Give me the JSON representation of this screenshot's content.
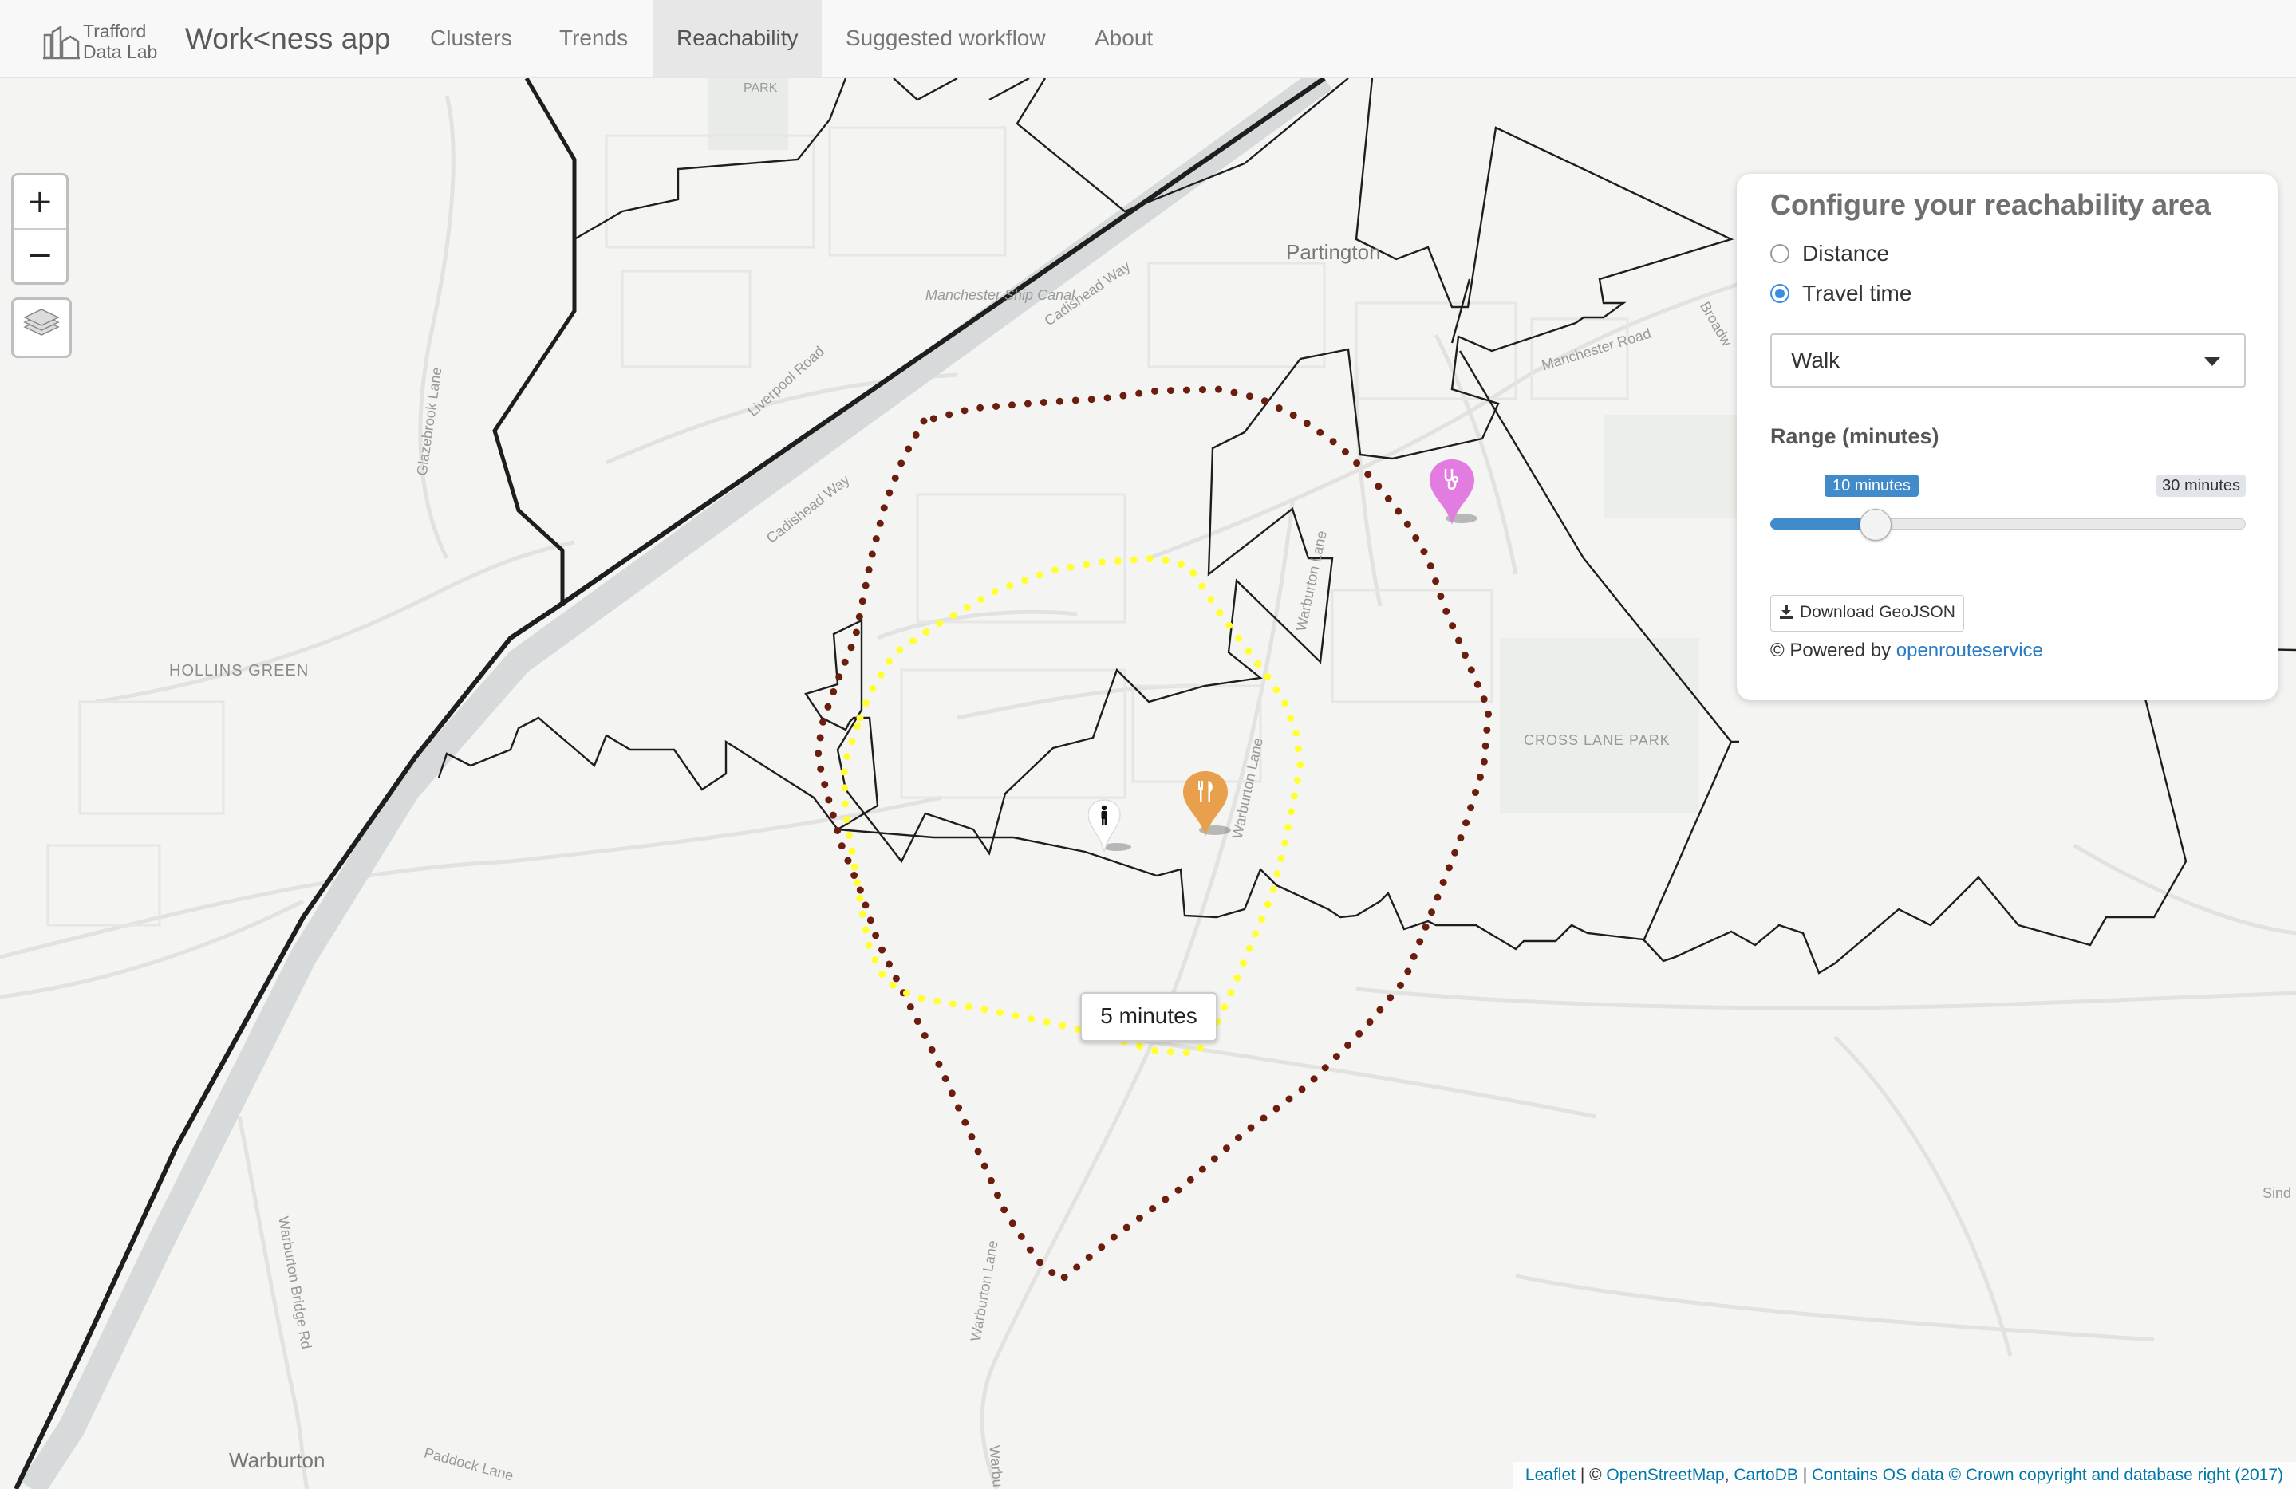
{
  "navbar": {
    "logo_text_line1": "Trafford",
    "logo_text_line2": "Data Lab",
    "brand": "Work<ness app",
    "items": [
      {
        "label": "Clusters",
        "active": false
      },
      {
        "label": "Trends",
        "active": false
      },
      {
        "label": "Reachability",
        "active": true
      },
      {
        "label": "Suggested workflow",
        "active": false
      },
      {
        "label": "About",
        "active": false
      }
    ]
  },
  "map": {
    "zoom_in": "+",
    "zoom_out": "−",
    "layers_icon": "layers-icon",
    "place_labels": {
      "partington": "Partington",
      "hollins_green": "HOLLINS GREEN",
      "warburton": "Warburton",
      "cross_lane_park": "CROSS LANE PARK",
      "park": "PARK"
    },
    "road_labels": {
      "cadishead_way_1": "Cadishead Way",
      "cadishead_way_2": "Cadishead Way",
      "liverpool_road": "Liverpool Road",
      "glazebrook_lane": "Glazebrook Lane",
      "manchester_road": "Manchester Road",
      "warburton_lane_1": "Warburton Lane",
      "warburton_lane_2": "Warburton Lane",
      "warburton_lane_3": "Warburton Lane",
      "warburton_bridge_rd": "Warburton Bridge Rd",
      "paddock_lane": "Paddock Lane",
      "ship_canal": "Manchester Ship Canal",
      "warburton_lane_4": "Warbu",
      "broadway": "Broadw",
      "sinderland": "Sind"
    },
    "isochrones": [
      {
        "minutes": 5,
        "color": "#ffff33",
        "style": "dotted"
      },
      {
        "minutes": 10,
        "color": "#6b1d0e",
        "style": "dotted"
      }
    ],
    "tooltip": "5 minutes",
    "markers": [
      {
        "type": "person",
        "icon": "person-icon",
        "color": "#ffffff"
      },
      {
        "type": "restaurant",
        "icon": "cutlery-icon",
        "color": "#e8a04c"
      },
      {
        "type": "health",
        "icon": "stethoscope-icon",
        "color": "#e27ce0"
      }
    ],
    "attribution": {
      "leaflet": "Leaflet",
      "sep1": " | © ",
      "osm": "OpenStreetMap",
      "comma": ", ",
      "carto": "CartoDB",
      "sep2": " | ",
      "os": "Contains OS data © Crown copyright and database right (2017)"
    }
  },
  "panel": {
    "title": "Configure your reachability area",
    "options": [
      {
        "label": "Distance",
        "checked": false
      },
      {
        "label": "Travel time",
        "checked": true
      }
    ],
    "mode_selected": "Walk",
    "range_label": "Range (minutes)",
    "slider": {
      "value": 10,
      "value_label": "10 minutes",
      "min": 5,
      "max": 30,
      "max_label": "30 minutes"
    },
    "download_label": "Download GeoJSON",
    "download_icon": "download-icon",
    "powered_prefix": "© Powered by ",
    "powered_link": "openrouteservice"
  },
  "colors": {
    "nav_active_bg": "#e7e7e7",
    "accent": "#428bca",
    "isochrone_5": "#ffff33",
    "isochrone_10": "#6b1d0e"
  }
}
